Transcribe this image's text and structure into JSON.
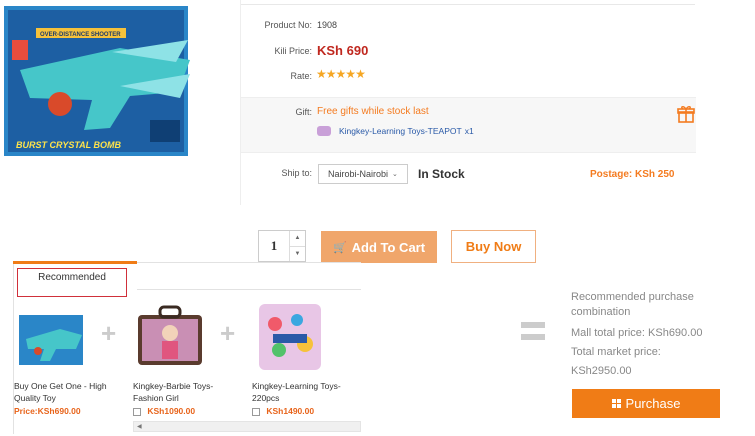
{
  "product": {
    "product_no_label": "Product No:",
    "product_no": "1908",
    "kili_price_label": "Kili Price:",
    "kili_price": "KSh 690",
    "rate_label": "Rate:",
    "rating_stars": 5,
    "gift_label": "Gift:",
    "gift_text": "Free gifts while stock last",
    "gift_item": "Kingkey-Learning Toys-TEAPOT",
    "gift_qty": "x1",
    "ship_label": "Ship to:",
    "ship_value": "Nairobi-Nairobi",
    "stock": "In Stock",
    "postage": "Postage: KSh 250",
    "quantity": "1",
    "add_to_cart": "Add To Cart",
    "buy_now": "Buy Now"
  },
  "packshot_text": {
    "line1": "OVER-DISTANCE SHOOTER",
    "brand": "BURST CRYSTAL BOMB"
  },
  "recommended": {
    "tab_label": "Recommended",
    "items": [
      {
        "title": "Buy One Get One - High Quality Toy",
        "price": "Price:KSh690.00"
      },
      {
        "title": "Kingkey-Barbie Toys-Fashion Girl",
        "price": "KSh1090.00"
      },
      {
        "title": "Kingkey-Learning Toys-220pcs",
        "price": "KSh1490.00"
      }
    ]
  },
  "combo": {
    "heading": "Recommended purchase combination",
    "mall_total": "Mall total price: KSh690.00",
    "market_total_label": "Total market price:",
    "market_total_value": "KSh2950.00",
    "purchase_button": "Purchase"
  },
  "colors": {
    "price_red": "#c0281f",
    "orange": "#f47b20",
    "add_cart_bg": "#f0a66b",
    "purchase_bg": "#f07c16"
  }
}
